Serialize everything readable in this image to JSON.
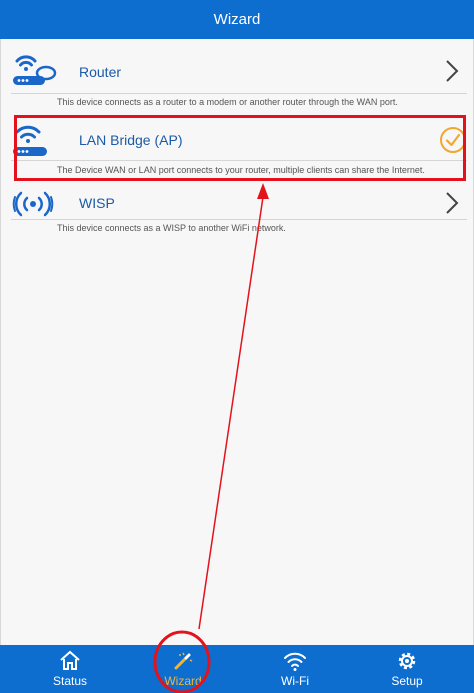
{
  "header": {
    "title": "Wizard"
  },
  "modes": [
    {
      "title": "Router",
      "description": "This device connects as a router to a modem or another router through the WAN port.",
      "icon": "router-wifi-cloud-icon",
      "indicator": "chevron-right-icon",
      "selected": false
    },
    {
      "title": "LAN Bridge (AP)",
      "description": "The Device WAN or LAN port connects to your router, multiple clients can share the Internet.",
      "icon": "access-point-wifi-icon",
      "indicator": "check-circle-icon",
      "selected": true
    },
    {
      "title": "WISP",
      "description": "This device connects as a WISP to another WiFi network.",
      "icon": "wireless-signal-icon",
      "indicator": "chevron-right-icon",
      "selected": false
    }
  ],
  "tabs": [
    {
      "label": "Status",
      "icon": "home-icon",
      "active": false
    },
    {
      "label": "Wizard",
      "icon": "magic-wand-icon",
      "active": true
    },
    {
      "label": "Wi-Fi",
      "icon": "wifi-icon",
      "active": false
    },
    {
      "label": "Setup",
      "icon": "gear-icon",
      "active": false
    }
  ],
  "colors": {
    "brand": "#0d6ed0",
    "title_text": "#1b5aa6",
    "active_tab": "#f0b43a",
    "check": "#f0a830",
    "annotation": "#e4121b"
  }
}
